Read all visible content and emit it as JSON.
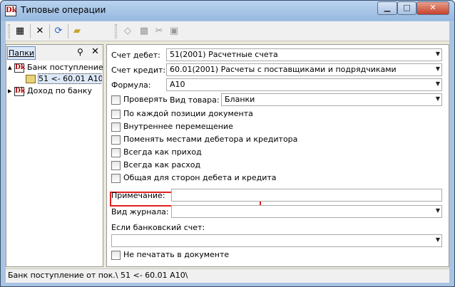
{
  "window": {
    "title": "Типовые операции",
    "app_icon": "Dk"
  },
  "tree_panel": {
    "tab_label": "Папки",
    "items": [
      {
        "label": "Банк поступление о"
      },
      {
        "label": "51 <- 60.01 А10"
      },
      {
        "label": "Доход по банку"
      }
    ]
  },
  "form": {
    "debit": {
      "label": "Счет дебет:",
      "value": "51(2001) Расчетные счета"
    },
    "credit": {
      "label": "Счет кредит:",
      "value": "60.01(2001) Расчеты с поставщиками и подрядчиками"
    },
    "formula": {
      "label": "Формула:",
      "value": "А10"
    },
    "check_label": "Проверять",
    "goods_type": {
      "label": "Вид товара:",
      "value": "Бланки"
    },
    "checkboxes": [
      "По каждой позиции документа",
      "Внутреннее перемещение",
      "Поменять местами дебетора и кредитора",
      "Всегда как приход",
      "Всегда как расход",
      "Общая для сторон дебета и кредита"
    ],
    "note_label": "Примечание:",
    "note_value": "",
    "journal_label": "Вид журнала:",
    "journal_value": "",
    "bank_label": "Если банковский счет:",
    "bank_value": "",
    "no_print_label": "Не печатать в документе"
  },
  "status": {
    "text": "Банк поступление от пок.\\ 51 <- 60.01 А10\\"
  },
  "colors": {
    "highlight": "#e02020",
    "title_gradient_top": "#b9d3ef",
    "close_button": "#c6402a"
  }
}
